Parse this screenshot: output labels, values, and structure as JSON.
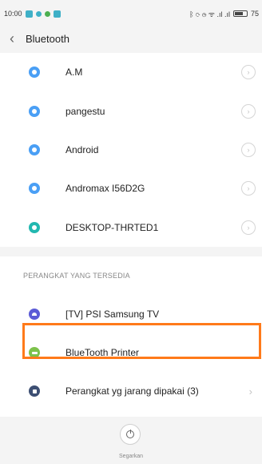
{
  "status_bar": {
    "time": "10:00",
    "signal_text": "ᛒ ⟳ ◷ ᯤ .ıl .ıl",
    "battery_text": "75",
    "battery_level": 0.75
  },
  "header": {
    "back_glyph": "‹",
    "title": "Bluetooth"
  },
  "paired_devices": [
    {
      "name": "A.M",
      "color": "#4a9ff5"
    },
    {
      "name": "pangestu",
      "color": "#4a9ff5"
    },
    {
      "name": "Android",
      "color": "#4a9ff5"
    },
    {
      "name": "Andromax I56D2G",
      "color": "#4a9ff5"
    },
    {
      "name": "DESKTOP-THRTED1",
      "color": "#22b8b0"
    }
  ],
  "available_section": {
    "header": "PERANGKAT YANG TERSEDIA",
    "devices": [
      {
        "name": "[TV] PSI Samsung TV",
        "color": "#5b5bd6",
        "icon": "tv-icon"
      },
      {
        "name": "BlueTooth Printer",
        "color": "#7dc24b",
        "icon": "printer-icon"
      },
      {
        "name": "Perangkat yg jarang dipakai (3)",
        "color": "#3d4f73",
        "icon": "device-icon"
      }
    ]
  },
  "detail_glyph": "›",
  "chevron_glyph": "›",
  "refresh": {
    "label": "Segarkan"
  },
  "colors": {
    "highlight": "#ff7a1a"
  }
}
